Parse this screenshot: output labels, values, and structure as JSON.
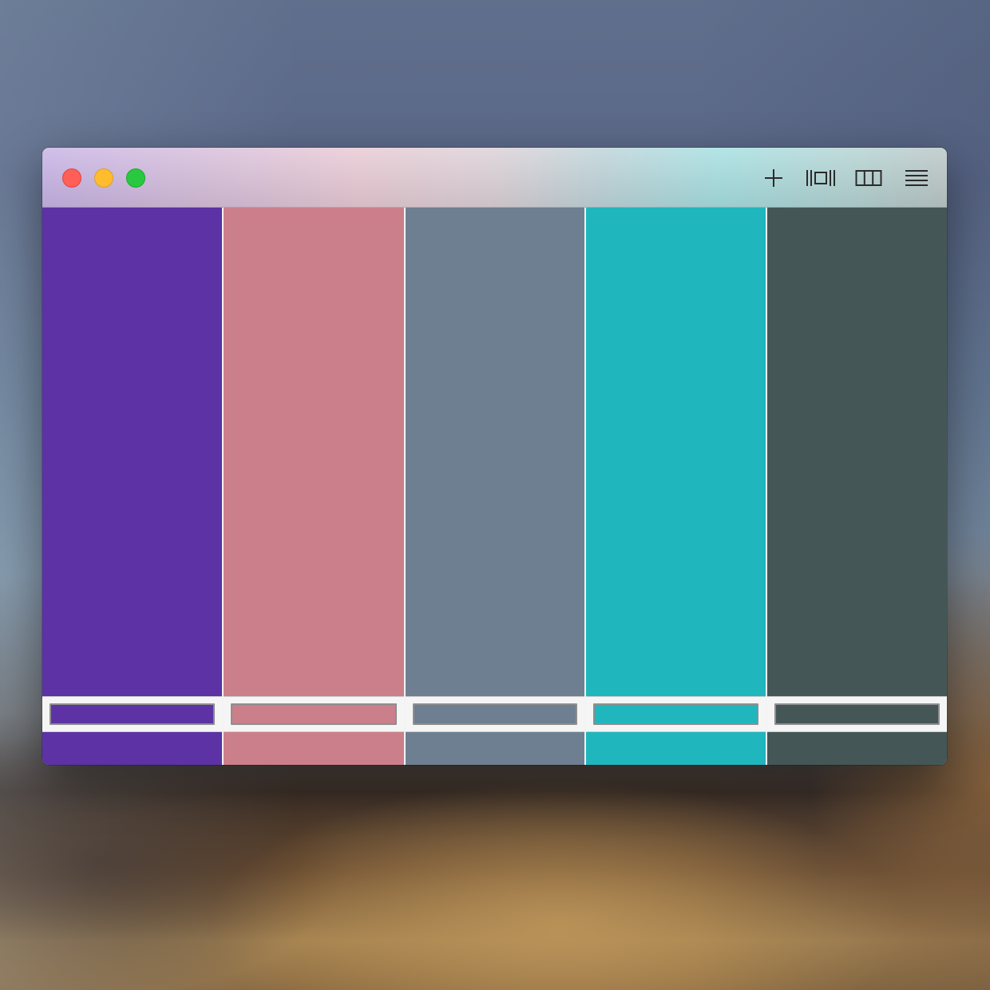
{
  "window": {
    "traffic_lights": {
      "close": "#ff5f57",
      "minimize": "#febc2e",
      "zoom": "#28c840"
    },
    "toolbar": [
      {
        "id": "add",
        "icon": "plus-icon"
      },
      {
        "id": "fit",
        "icon": "fit-width-icon"
      },
      {
        "id": "columns",
        "icon": "columns-icon"
      },
      {
        "id": "menu",
        "icon": "hamburger-menu-icon"
      }
    ]
  },
  "palette": {
    "colors": [
      {
        "hex": "#5c32a4",
        "input_value": ""
      },
      {
        "hex": "#cb7f8a",
        "input_value": ""
      },
      {
        "hex": "#6e7f91",
        "input_value": ""
      },
      {
        "hex": "#20b6be",
        "input_value": ""
      },
      {
        "hex": "#445756",
        "input_value": ""
      }
    ]
  }
}
